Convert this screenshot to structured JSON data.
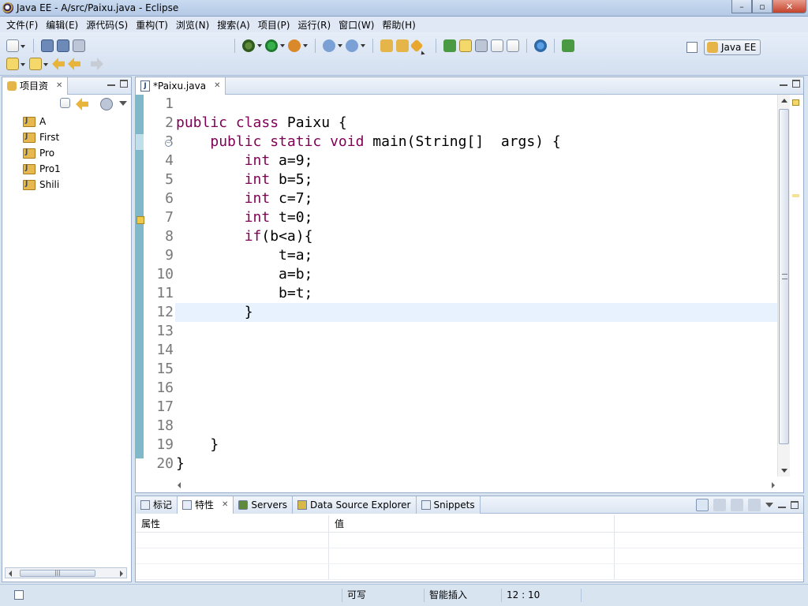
{
  "window": {
    "title": "Java EE  -  A/src/Paixu.java  -  Eclipse",
    "min_label": "–",
    "max_label": "▫",
    "close_label": "✕"
  },
  "menu": [
    "文件(F)",
    "编辑(E)",
    "源代码(S)",
    "重构(T)",
    "浏览(N)",
    "搜索(A)",
    "项目(P)",
    "运行(R)",
    "窗口(W)",
    "帮助(H)"
  ],
  "toolbar": {
    "perspective_label": "Java EE"
  },
  "left_panel": {
    "tab_label": "项目资",
    "close": "✕",
    "projects": [
      "A",
      "First",
      "Pro",
      "Pro1",
      "Shili"
    ],
    "scroll_grip": "|||"
  },
  "editor": {
    "tab_label": "*Paixu.java",
    "close": "✕",
    "line_numbers": [
      "1",
      "2",
      "3",
      "4",
      "5",
      "6",
      "7",
      "8",
      "9",
      "10",
      "11",
      "12",
      "13",
      "14",
      "15",
      "16",
      "17",
      "18",
      "19",
      "20"
    ],
    "current_line": 12,
    "lines": [
      [],
      [
        {
          "t": "public class",
          "k": true
        },
        {
          "t": " Paixu {"
        }
      ],
      [
        {
          "t": "    "
        },
        {
          "t": "public static void",
          "k": true
        },
        {
          "t": " main(String[]  args) {"
        }
      ],
      [
        {
          "t": "        "
        },
        {
          "t": "int",
          "k": true
        },
        {
          "t": " a=9;"
        }
      ],
      [
        {
          "t": "        "
        },
        {
          "t": "int",
          "k": true
        },
        {
          "t": " b=5;"
        }
      ],
      [
        {
          "t": "        "
        },
        {
          "t": "int",
          "k": true
        },
        {
          "t": " c=7;"
        }
      ],
      [
        {
          "t": "        "
        },
        {
          "t": "int",
          "k": true
        },
        {
          "t": " t=0;"
        }
      ],
      [
        {
          "t": "        "
        },
        {
          "t": "if",
          "k": true
        },
        {
          "t": "(b<a){"
        }
      ],
      [
        {
          "t": "            t=a;"
        }
      ],
      [
        {
          "t": "            a=b;"
        }
      ],
      [
        {
          "t": "            b=t;"
        }
      ],
      [
        {
          "t": "        }"
        }
      ],
      [],
      [],
      [],
      [],
      [],
      [],
      [
        {
          "t": "    }"
        }
      ],
      [
        {
          "t": "}"
        }
      ]
    ]
  },
  "bottom_panel": {
    "tabs": [
      {
        "label": "标记",
        "icon": "markers-icon"
      },
      {
        "label": "特性",
        "icon": "properties-icon",
        "active": true
      },
      {
        "label": "Servers",
        "icon": "servers-icon"
      },
      {
        "label": "Data Source Explorer",
        "icon": "data-source-icon"
      },
      {
        "label": "Snippets",
        "icon": "snippets-icon"
      }
    ],
    "close": "✕",
    "columns": [
      "属性",
      "值",
      ""
    ]
  },
  "status": {
    "writable": "可写",
    "insert_mode": "智能插入",
    "position": "12 : 10"
  }
}
